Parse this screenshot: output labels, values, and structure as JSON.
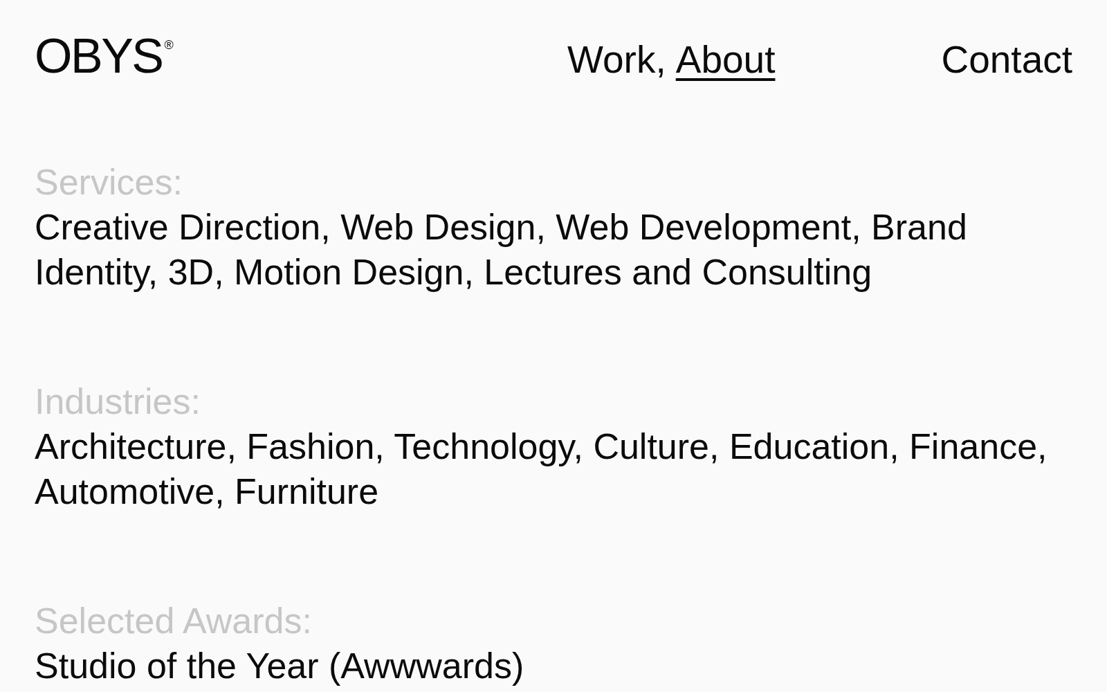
{
  "logo": {
    "text": "OBYS$^{®}$"
  },
  "nav": [
    {
      "label": "Work,",
      "selected": false
    },
    {
      "label": "About",
      "selected": true
    }
  ],
  "contact": {
    "label": "Contact"
  },
  "sections": [
    {
      "label": "Services:",
      "text": "Creative Direction, Web Design, Web Development, Brand Identity, 3D, Motion Design, Lectures and Consulting"
    },
    {
      "label": "Industries:",
      "text": "Architecture, Fashion, Technology, Culture, Education, Finance, Automotive, Furniture"
    },
    {
      "label": "Selected Awards:",
      "text": "Studio of the Year (Awwwards)"
    }
  ]
}
